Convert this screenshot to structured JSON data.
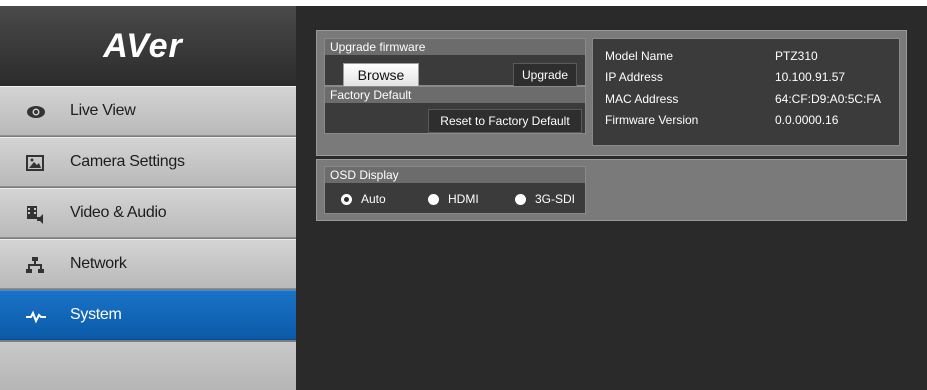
{
  "brand": {
    "logo_text": "AVer"
  },
  "sidebar": {
    "items": [
      {
        "label": "Live View",
        "icon": "eye-icon"
      },
      {
        "label": "Camera Settings",
        "icon": "image-icon"
      },
      {
        "label": "Video & Audio",
        "icon": "film-audio-icon"
      },
      {
        "label": "Network",
        "icon": "network-icon"
      },
      {
        "label": "System",
        "icon": "pulse-icon",
        "active": true
      }
    ]
  },
  "firmware": {
    "title": "Upgrade firmware",
    "browse_label": "Browse",
    "upgrade_label": "Upgrade"
  },
  "factory": {
    "title": "Factory Default",
    "reset_label": "Reset to Factory Default"
  },
  "device_info": {
    "model_label": "Model Name",
    "model_value": "PTZ310",
    "ip_label": "IP Address",
    "ip_value": "10.100.91.57",
    "mac_label": "MAC Address",
    "mac_value": "64:CF:D9:A0:5C:FA",
    "fw_label": "Firmware Version",
    "fw_value": "0.0.0000.16"
  },
  "osd": {
    "title": "OSD Display",
    "options": [
      {
        "label": "Auto",
        "selected": true
      },
      {
        "label": "HDMI",
        "selected": false
      },
      {
        "label": "3G-SDI",
        "selected": false
      }
    ]
  },
  "colors": {
    "accent": "#0a5aa8",
    "main_bg": "#2a2a2a",
    "panel_bg": "#7a7a7a"
  }
}
